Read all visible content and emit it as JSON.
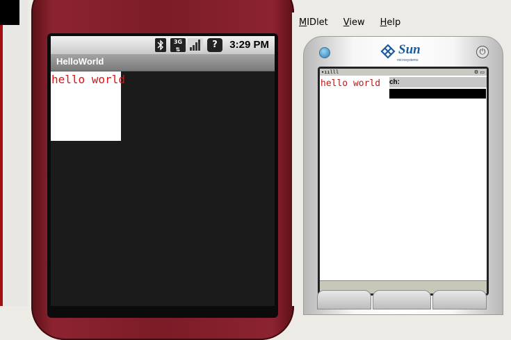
{
  "android": {
    "status_bar": {
      "icons": [
        "bluetooth-icon",
        "3g-icon",
        "signal-icon",
        "unknown-sim-icon"
      ],
      "g3_label": "3G",
      "q_label": "?",
      "time": "3:29 PM"
    },
    "app_title": "HelloWorld",
    "content_text": "hello world",
    "text_color": "#e01010",
    "body_color": "#8c2330"
  },
  "wtk": {
    "menu": [
      {
        "label": "MIDlet",
        "mnemonic": "M",
        "rest": "IDlet"
      },
      {
        "label": "View",
        "mnemonic": "V",
        "rest": "iew"
      },
      {
        "label": "Help",
        "mnemonic": "H",
        "rest": "elp"
      }
    ],
    "brand": "Sun",
    "brand_sub": "microsystems",
    "screen": {
      "content_text": "hello world",
      "label_text": "ch:",
      "text_color": "#c41414"
    }
  }
}
